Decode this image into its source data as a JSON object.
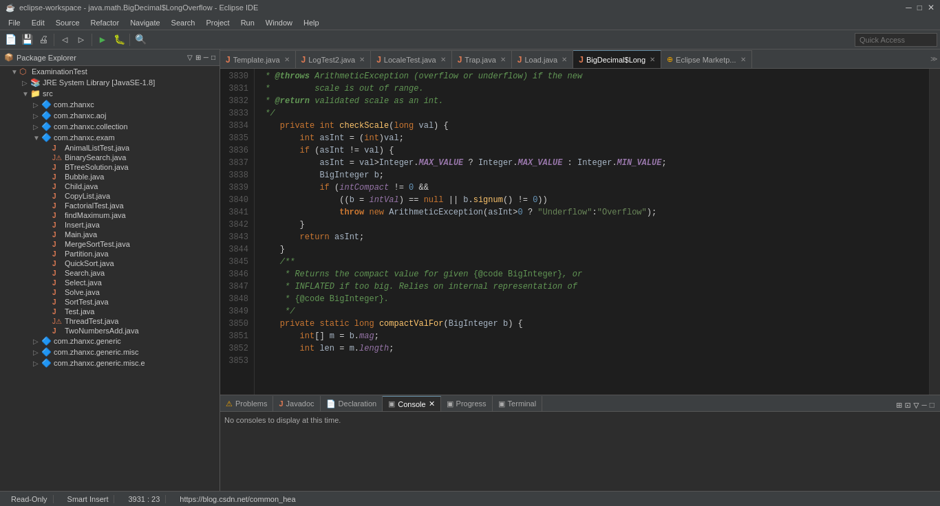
{
  "titleBar": {
    "title": "eclipse-workspace - java.math.BigDecimal$LongOverflow - Eclipse IDE",
    "icon": "☕",
    "minimize": "─",
    "maximize": "□",
    "close": "✕"
  },
  "menuBar": {
    "items": [
      "File",
      "Edit",
      "Source",
      "Refactor",
      "Navigate",
      "Search",
      "Project",
      "Run",
      "Window",
      "Help"
    ]
  },
  "quickAccess": {
    "placeholder": "Quick Access"
  },
  "tabs": [
    {
      "id": "template",
      "label": "Template.java",
      "icon": "J",
      "active": false
    },
    {
      "id": "logtest",
      "label": "LogTest2.java",
      "icon": "J",
      "active": false
    },
    {
      "id": "locale",
      "label": "LocaleTest.java",
      "icon": "J",
      "active": false
    },
    {
      "id": "trap",
      "label": "Trap.java",
      "icon": "J",
      "active": false
    },
    {
      "id": "load",
      "label": "Load.java",
      "icon": "J",
      "active": false
    },
    {
      "id": "bigdecimal",
      "label": "BigDecimal$Long",
      "icon": "J",
      "active": true
    },
    {
      "id": "marketplace",
      "label": "Eclipse Marketp...",
      "icon": "E",
      "active": false
    }
  ],
  "sidebar": {
    "title": "Package Explorer",
    "items": [
      {
        "label": "ExaminationTest",
        "indent": 1,
        "arrow": "▼",
        "icon": "📁",
        "type": "project"
      },
      {
        "label": "JRE System Library [JavaSE-1.8]",
        "indent": 2,
        "arrow": "▷",
        "icon": "📚",
        "type": "library"
      },
      {
        "label": "src",
        "indent": 2,
        "arrow": "▼",
        "icon": "📁",
        "type": "folder"
      },
      {
        "label": "com.zhanxc",
        "indent": 3,
        "arrow": "▷",
        "icon": "📦",
        "type": "package"
      },
      {
        "label": "com.zhanxc.aoj",
        "indent": 3,
        "arrow": "▷",
        "icon": "📦",
        "type": "package"
      },
      {
        "label": "com.zhanxc.collection",
        "indent": 3,
        "arrow": "▷",
        "icon": "📦",
        "type": "package"
      },
      {
        "label": "com.zhanxc.exam",
        "indent": 3,
        "arrow": "▼",
        "icon": "📦",
        "type": "package"
      },
      {
        "label": "AnimalListTest.java",
        "indent": 4,
        "arrow": "",
        "icon": "J",
        "type": "java"
      },
      {
        "label": "BinarySearch.java",
        "indent": 4,
        "arrow": "",
        "icon": "J",
        "type": "java-error"
      },
      {
        "label": "BTreeSolution.java",
        "indent": 4,
        "arrow": "",
        "icon": "J",
        "type": "java"
      },
      {
        "label": "Bubble.java",
        "indent": 4,
        "arrow": "",
        "icon": "J",
        "type": "java"
      },
      {
        "label": "Child.java",
        "indent": 4,
        "arrow": "",
        "icon": "J",
        "type": "java"
      },
      {
        "label": "CopyList.java",
        "indent": 4,
        "arrow": "",
        "icon": "J",
        "type": "java"
      },
      {
        "label": "FactorialTest.java",
        "indent": 4,
        "arrow": "",
        "icon": "J",
        "type": "java"
      },
      {
        "label": "findMaximum.java",
        "indent": 4,
        "arrow": "",
        "icon": "J",
        "type": "java"
      },
      {
        "label": "Insert.java",
        "indent": 4,
        "arrow": "",
        "icon": "J",
        "type": "java"
      },
      {
        "label": "Main.java",
        "indent": 4,
        "arrow": "",
        "icon": "J",
        "type": "java"
      },
      {
        "label": "MergeSortTest.java",
        "indent": 4,
        "arrow": "",
        "icon": "J",
        "type": "java"
      },
      {
        "label": "Partition.java",
        "indent": 4,
        "arrow": "",
        "icon": "J",
        "type": "java"
      },
      {
        "label": "QuickSort.java",
        "indent": 4,
        "arrow": "",
        "icon": "J",
        "type": "java"
      },
      {
        "label": "Search.java",
        "indent": 4,
        "arrow": "",
        "icon": "J",
        "type": "java"
      },
      {
        "label": "Select.java",
        "indent": 4,
        "arrow": "",
        "icon": "J",
        "type": "java"
      },
      {
        "label": "Solve.java",
        "indent": 4,
        "arrow": "",
        "icon": "J",
        "type": "java"
      },
      {
        "label": "SortTest.java",
        "indent": 4,
        "arrow": "",
        "icon": "J",
        "type": "java"
      },
      {
        "label": "Test.java",
        "indent": 4,
        "arrow": "",
        "icon": "J",
        "type": "java"
      },
      {
        "label": "ThreadTest.java",
        "indent": 4,
        "arrow": "",
        "icon": "J",
        "type": "java-error"
      },
      {
        "label": "TwoNumbersAdd.java",
        "indent": 4,
        "arrow": "",
        "icon": "J",
        "type": "java"
      },
      {
        "label": "com.zhanxc.generic",
        "indent": 3,
        "arrow": "▷",
        "icon": "📦",
        "type": "package"
      },
      {
        "label": "com.zhanxc.generic.misc",
        "indent": 3,
        "arrow": "▷",
        "icon": "📦",
        "type": "package"
      },
      {
        "label": "com.zhanxc.generic.misc.e",
        "indent": 3,
        "arrow": "▷",
        "icon": "📦",
        "type": "package"
      }
    ]
  },
  "bottomTabs": {
    "items": [
      {
        "label": "Problems",
        "icon": "⚠",
        "active": false
      },
      {
        "label": "Javadoc",
        "icon": "J",
        "active": false
      },
      {
        "label": "Declaration",
        "icon": "📄",
        "active": false
      },
      {
        "label": "Console",
        "icon": "▣",
        "active": true
      },
      {
        "label": "Progress",
        "icon": "▣",
        "active": false
      },
      {
        "label": "Terminal",
        "icon": "▣",
        "active": false
      }
    ],
    "consoleMessage": "No consoles to display at this time."
  },
  "statusBar": {
    "readOnly": "Read-Only",
    "insertMode": "Smart Insert",
    "position": "3931 : 23",
    "url": "https://blog.csdn.net/common_hea"
  },
  "codeLines": [
    {
      "num": "3830",
      "code": " * <b>@throws</b> ArithmeticException (overflow or underflow) if the new"
    },
    {
      "num": "3831",
      "code": " *         scale is out of range."
    },
    {
      "num": "3832",
      "code": " * <b>@return</b> validated scale as an int."
    },
    {
      "num": "3833",
      "code": " */"
    },
    {
      "num": "3834",
      "code": " private int checkScale(long val) {"
    },
    {
      "num": "3835",
      "code": "     int asInt = (int)val;"
    },
    {
      "num": "3836",
      "code": "     if (asInt != val) {"
    },
    {
      "num": "3837",
      "code": "         asInt = val>Integer.MAX_VALUE ? Integer.MAX_VALUE : Integer.MIN_VALUE;"
    },
    {
      "num": "3838",
      "code": "         BigInteger b;"
    },
    {
      "num": "3839",
      "code": "         if (intCompact != 0 &&"
    },
    {
      "num": "3840",
      "code": "             ((b = intVal) == null || b.signum() != 0))"
    },
    {
      "num": "3841",
      "code": "             throw new ArithmeticException(asInt>0 ? \"Underflow\":\"Overflow\");"
    },
    {
      "num": "3842",
      "code": "     }"
    },
    {
      "num": "3843",
      "code": "     return asInt;"
    },
    {
      "num": "3844",
      "code": " }"
    },
    {
      "num": "3845",
      "code": ""
    },
    {
      "num": "3846",
      "code": " /**"
    },
    {
      "num": "3847",
      "code": "  * Returns the compact value for given {@code BigInteger}, or"
    },
    {
      "num": "3848",
      "code": "  * INFLATED if too big. Relies on internal representation of"
    },
    {
      "num": "3849",
      "code": "  * {@code BigInteger}."
    },
    {
      "num": "3850",
      "code": "  */"
    },
    {
      "num": "3851",
      "code": " private static long compactValFor(BigInteger b) {"
    },
    {
      "num": "3852",
      "code": "     int[] m = b.mag;"
    },
    {
      "num": "3853",
      "code": "     int len = m.length;"
    }
  ]
}
